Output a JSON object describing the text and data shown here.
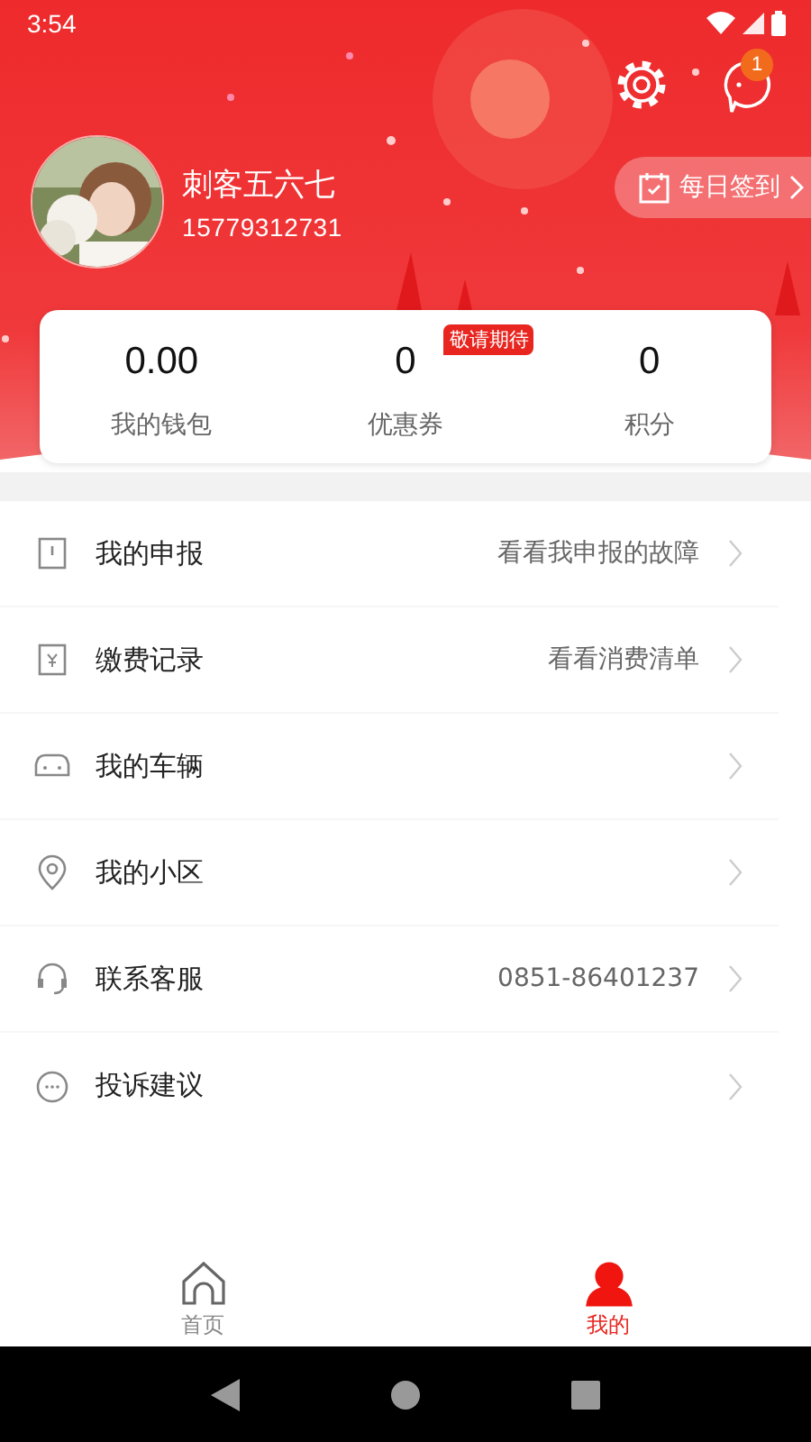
{
  "status_bar": {
    "time": "3:54"
  },
  "header": {
    "notification_count": "1",
    "user": {
      "name": "刺客五六七",
      "phone": "15779312731"
    },
    "checkin": {
      "label": "每日签到"
    }
  },
  "stats": [
    {
      "value": "0.00",
      "label": "我的钱包"
    },
    {
      "value": "0",
      "label": "优惠券",
      "badge": "敬请期待"
    },
    {
      "value": "0",
      "label": "积分"
    }
  ],
  "menu": [
    {
      "kind": "report",
      "label": "我的申报",
      "detail": "看看我申报的故障"
    },
    {
      "kind": "payment",
      "label": "缴费记录",
      "detail": "看看消费清单"
    },
    {
      "kind": "car",
      "label": "我的车辆"
    },
    {
      "kind": "location",
      "label": "我的小区"
    },
    {
      "kind": "support",
      "label": "联系客服",
      "detail": "0851-86401237"
    },
    {
      "kind": "feedback",
      "label": "投诉建议"
    }
  ],
  "tab_bar": [
    {
      "kind": "home",
      "label": "首页",
      "selected": false
    },
    {
      "kind": "profile",
      "label": "我的",
      "selected": true
    }
  ]
}
